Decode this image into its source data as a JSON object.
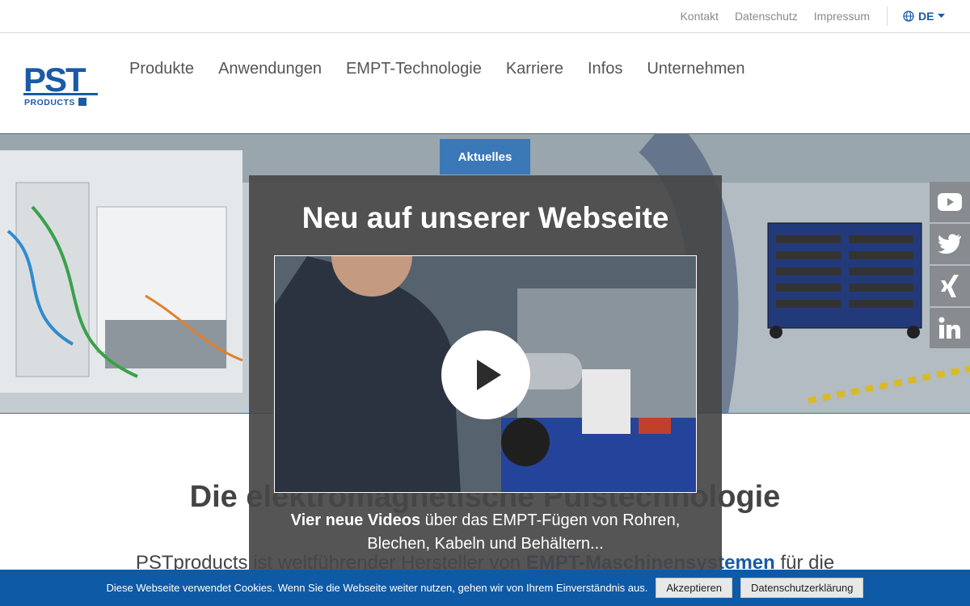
{
  "topbar": {
    "links": [
      "Kontakt",
      "Datenschutz",
      "Impressum"
    ],
    "language": "DE"
  },
  "logo": {
    "name": "PST",
    "sub": "PRODUCTS"
  },
  "nav": {
    "items": [
      "Produkte",
      "Anwendungen",
      "EMPT-Technologie",
      "Karriere",
      "Infos",
      "Unternehmen"
    ]
  },
  "hero": {
    "badge": "Aktuelles"
  },
  "social": {
    "icons": [
      "youtube-icon",
      "twitter-icon",
      "xing-icon",
      "linkedin-icon"
    ]
  },
  "main": {
    "heading": "Die elektromagnetische Pulstechnologie",
    "text_pre": "PSTproducts ist weltführender Hersteller von ",
    "text_bold": "EMPT-Maschinensystemen",
    "text_post": " für die"
  },
  "modal": {
    "title": "Neu auf unserer Webseite",
    "text_bold": "Vier neue Videos",
    "text_rest": " über das EMPT-Fügen von Rohren, Blechen, Kabeln und Behältern..."
  },
  "cookie": {
    "message": "Diese Webseite verwendet Cookies. Wenn Sie die Webseite weiter nutzen, gehen wir von Ihrem Einverständnis aus.",
    "accept": "Akzeptieren",
    "privacy": "Datenschutzerklärung"
  },
  "colors": {
    "brand_blue": "#1a5aa6",
    "cookie_bar": "#0f5aa7",
    "badge": "#3b78b7",
    "social": "#888c90"
  }
}
